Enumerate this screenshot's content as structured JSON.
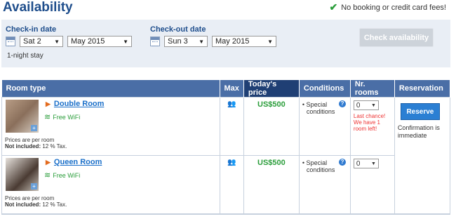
{
  "header": {
    "title": "Availability",
    "no_fees": "No booking or credit card fees!"
  },
  "search": {
    "checkin_label": "Check-in date",
    "checkin_day": "Sat 2",
    "checkin_month": "May 2015",
    "checkout_label": "Check-out date",
    "checkout_day": "Sun 3",
    "checkout_month": "May 2015",
    "check_button": "Check availability",
    "stay": "1-night stay"
  },
  "table": {
    "headers": {
      "room_type": "Room type",
      "max": "Max",
      "price": "Today's price",
      "conditions": "Conditions",
      "nr_rooms": "Nr. rooms",
      "reservation": "Reservation"
    },
    "rows": [
      {
        "name": "Double Room",
        "wifi": "Free WiFi",
        "price": "US$500",
        "cond_line1": "• Special",
        "cond_line2": "conditions",
        "nr": "0",
        "per_room": "Prices are per room",
        "not_included_label": "Not included:",
        "not_included_value": "12 % Tax.",
        "last_chance": "Last chance! We have 1 room left!"
      },
      {
        "name": "Queen Room",
        "wifi": "Free WiFi",
        "price": "US$500",
        "cond_line1": "• Special",
        "cond_line2": "conditions",
        "nr": "0",
        "per_room": "Prices are per room",
        "not_included_label": "Not included:",
        "not_included_value": "12 % Tax."
      }
    ],
    "reserve_button": "Reserve",
    "confirmation": "Confirmation is immediate"
  },
  "colors": {
    "header_bg": "#4a6ea6",
    "today_bg": "#1f3f74",
    "price_green": "#2a9d3a",
    "link_blue": "#1a6fc9",
    "alert_red": "#e33"
  }
}
